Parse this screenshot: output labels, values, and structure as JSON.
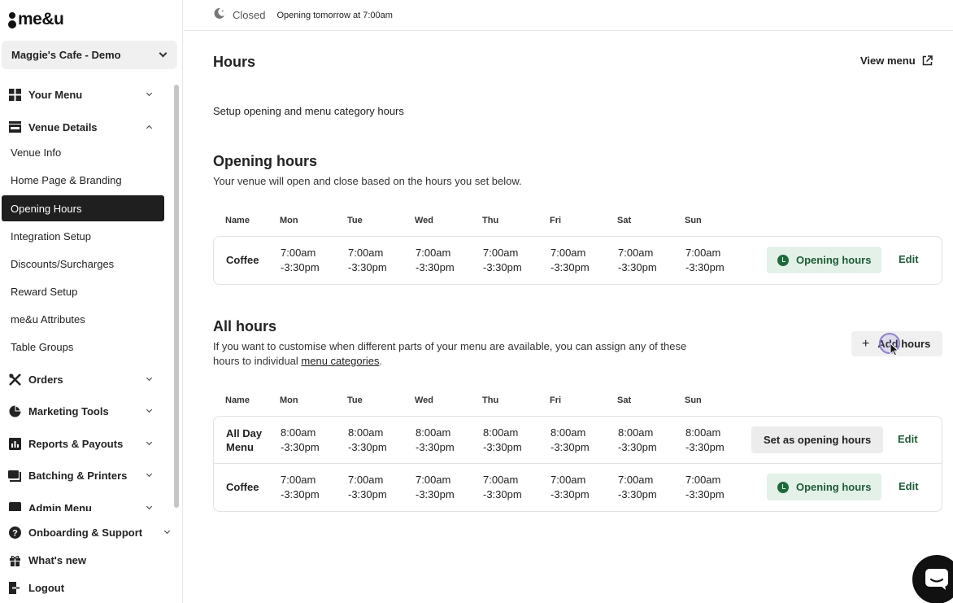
{
  "app": {
    "logo_text": "me&u"
  },
  "venue": {
    "name": "Maggie's Cafe - Demo"
  },
  "sidebar": {
    "sections": [
      {
        "label": "Your Menu",
        "icon": "grid-icon",
        "expanded": false
      },
      {
        "label": "Venue Details",
        "icon": "storefront-icon",
        "expanded": true
      },
      {
        "label": "Orders",
        "icon": "utensils-icon",
        "expanded": false
      },
      {
        "label": "Marketing Tools",
        "icon": "pie-chart-icon",
        "expanded": false
      },
      {
        "label": "Reports & Payouts",
        "icon": "bar-chart-icon",
        "expanded": false
      },
      {
        "label": "Batching & Printers",
        "icon": "printer-icon",
        "expanded": false
      },
      {
        "label": "Admin Menu",
        "icon": "admin-icon",
        "expanded": false
      }
    ],
    "venue_details_items": [
      {
        "label": "Venue Info",
        "active": false
      },
      {
        "label": "Home Page & Branding",
        "active": false
      },
      {
        "label": "Opening Hours",
        "active": true
      },
      {
        "label": "Integration Setup",
        "active": false
      },
      {
        "label": "Discounts/Surcharges",
        "active": false
      },
      {
        "label": "Reward Setup",
        "active": false
      },
      {
        "label": "me&u Attributes",
        "active": false
      },
      {
        "label": "Table Groups",
        "active": false
      }
    ],
    "bottom": [
      {
        "label": "Onboarding & Support",
        "icon": "help-icon"
      },
      {
        "label": "What's new",
        "icon": "gift-icon"
      },
      {
        "label": "Logout",
        "icon": "logout-icon"
      }
    ]
  },
  "topbar": {
    "status": "Closed",
    "next_open": "Opening tomorrow at 7:00am"
  },
  "page": {
    "title": "Hours",
    "view_menu": "View menu",
    "subtitle": "Setup opening and menu category hours"
  },
  "columns": [
    "Name",
    "Mon",
    "Tue",
    "Wed",
    "Thu",
    "Fri",
    "Sat",
    "Sun"
  ],
  "opening_hours": {
    "title": "Opening hours",
    "description": "Your venue will open and close based on the hours you set below.",
    "rows": [
      {
        "name": "Coffee",
        "days": [
          [
            "7:00am",
            "-3:30pm"
          ],
          [
            "7:00am",
            "-3:30pm"
          ],
          [
            "7:00am",
            "-3:30pm"
          ],
          [
            "7:00am",
            "-3:30pm"
          ],
          [
            "7:00am",
            "-3:30pm"
          ],
          [
            "7:00am",
            "-3:30pm"
          ],
          [
            "7:00am",
            "-3:30pm"
          ]
        ],
        "badge": "Opening hours",
        "edit": "Edit"
      }
    ]
  },
  "all_hours": {
    "title": "All hours",
    "description_1": "If you want to customise when different parts of your menu are available, you can assign any of these",
    "description_2": "hours to individual ",
    "description_link": "menu categories",
    "description_end": ".",
    "add_button": "Add hours",
    "rows": [
      {
        "name_1": "All Day",
        "name_2": "Menu",
        "days": [
          [
            "8:00am",
            "-3:30pm"
          ],
          [
            "8:00am",
            "-3:30pm"
          ],
          [
            "8:00am",
            "-3:30pm"
          ],
          [
            "8:00am",
            "-3:30pm"
          ],
          [
            "8:00am",
            "-3:30pm"
          ],
          [
            "8:00am",
            "-3:30pm"
          ],
          [
            "8:00am",
            "-3:30pm"
          ]
        ],
        "action": "Set as opening hours",
        "edit": "Edit"
      },
      {
        "name_1": "Coffee",
        "name_2": "",
        "days": [
          [
            "7:00am",
            "-3:30pm"
          ],
          [
            "7:00am",
            "-3:30pm"
          ],
          [
            "7:00am",
            "-3:30pm"
          ],
          [
            "7:00am",
            "-3:30pm"
          ],
          [
            "7:00am",
            "-3:30pm"
          ],
          [
            "7:00am",
            "-3:30pm"
          ],
          [
            "7:00am",
            "-3:30pm"
          ]
        ],
        "badge": "Opening hours",
        "edit": "Edit"
      }
    ]
  },
  "colors": {
    "accent_green": "#1e5c36",
    "badge_green_bg": "#e3f1e8",
    "active_nav_bg": "#1f1f1f"
  }
}
